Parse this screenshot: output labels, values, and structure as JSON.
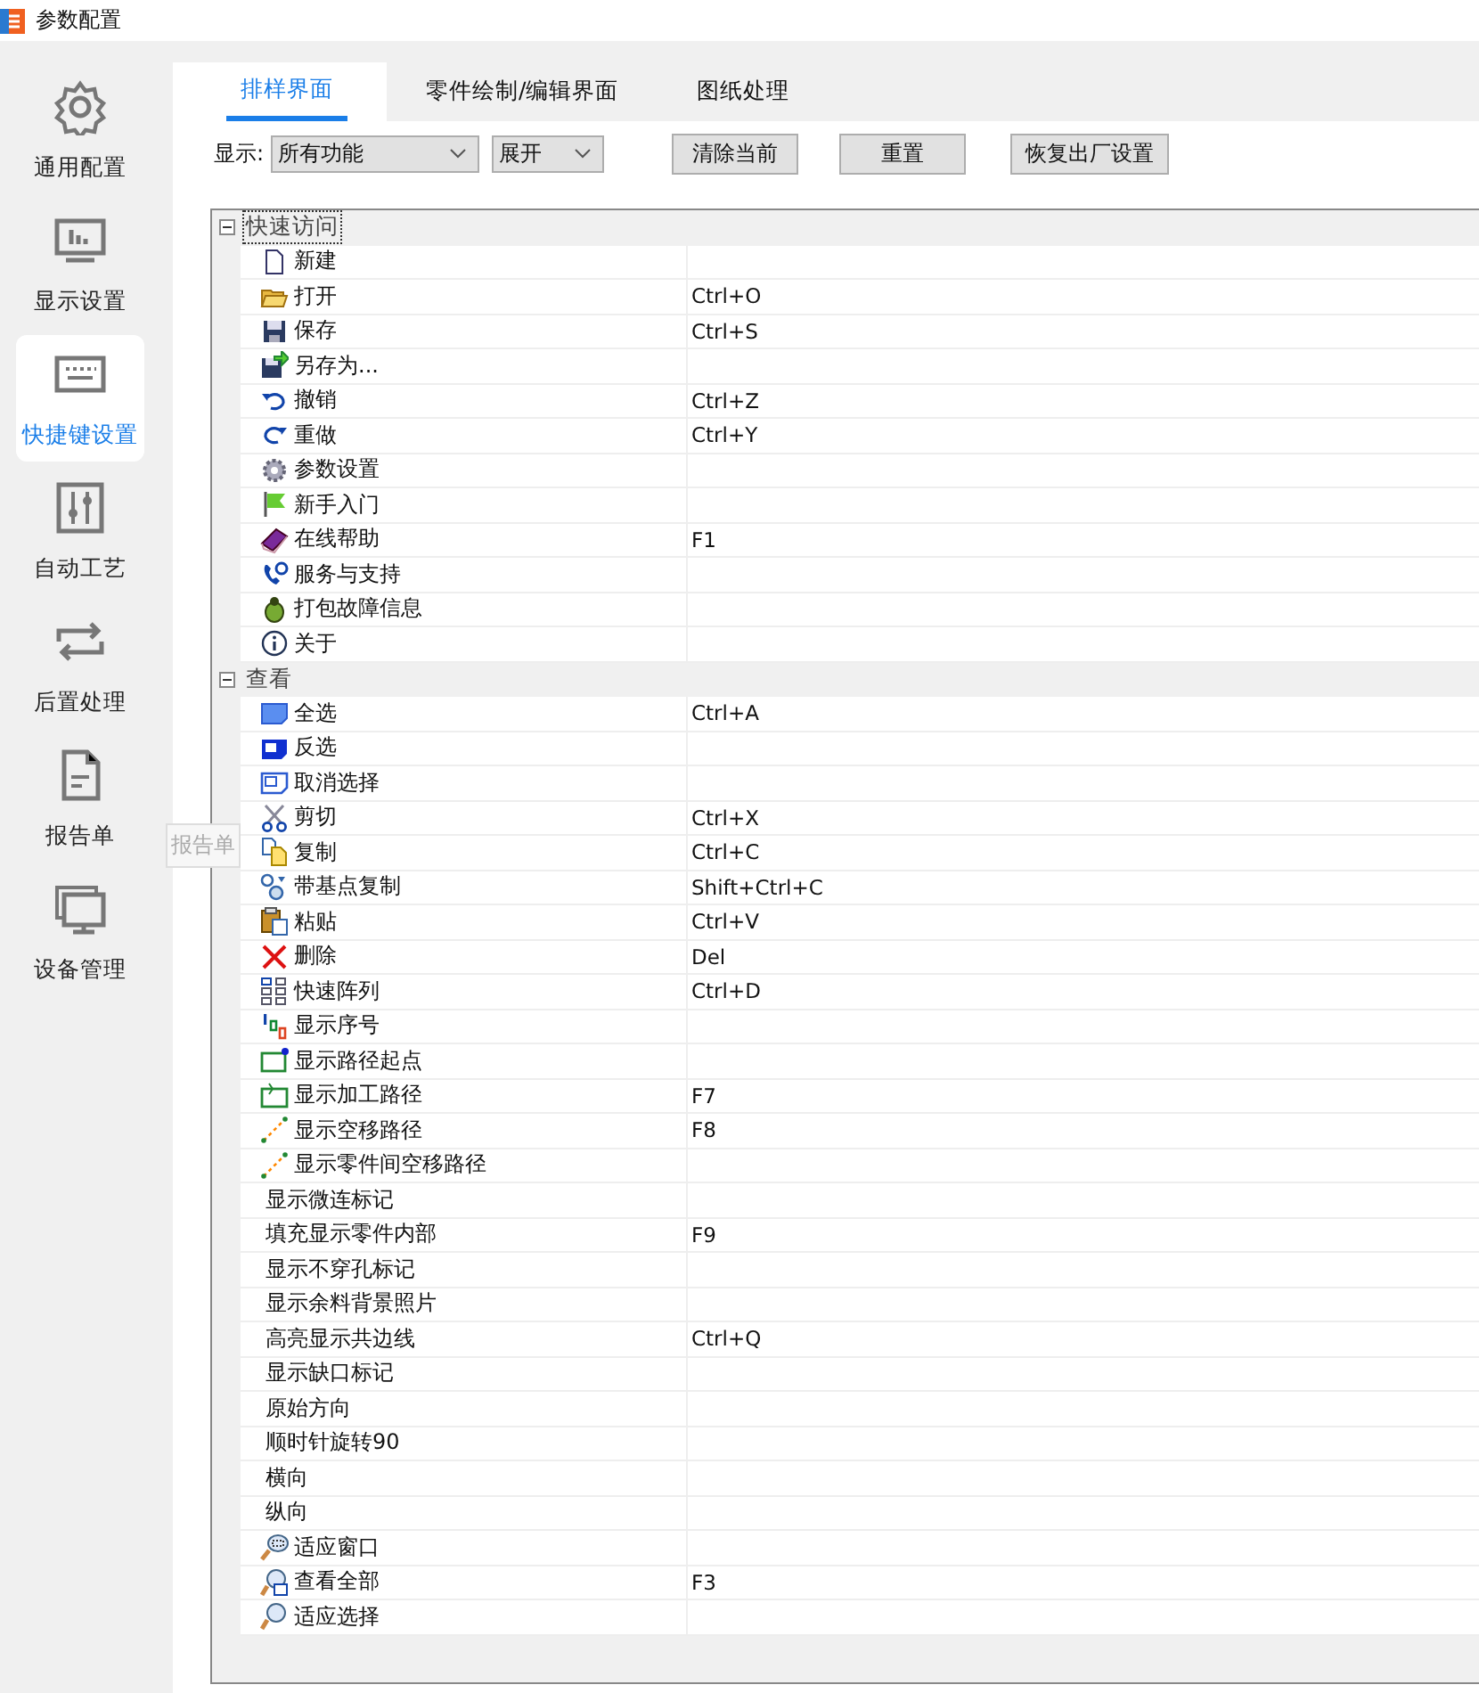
{
  "window": {
    "title": "参数配置"
  },
  "sidebar": {
    "items": [
      {
        "label": "通用配置",
        "kind": "gear",
        "selected": false
      },
      {
        "label": "显示设置",
        "kind": "display",
        "selected": false
      },
      {
        "label": "快捷键设置",
        "kind": "keyboard",
        "selected": true
      },
      {
        "label": "自动工艺",
        "kind": "sliders",
        "selected": false
      },
      {
        "label": "后置处理",
        "kind": "repeat",
        "selected": false
      },
      {
        "label": "报告单",
        "kind": "report",
        "selected": false
      },
      {
        "label": "设备管理",
        "kind": "monitor",
        "selected": false
      }
    ]
  },
  "tooltip": "报告单",
  "tabs": [
    {
      "label": "排样界面",
      "selected": true
    },
    {
      "label": "零件绘制/编辑界面",
      "selected": false
    },
    {
      "label": "图纸处理",
      "selected": false
    }
  ],
  "toolbar": {
    "label": "显示:",
    "filter": "所有功能",
    "expand": "展开",
    "buttons": [
      "清除当前",
      "重置",
      "恢复出厂设置"
    ]
  },
  "tree": [
    {
      "label": "快速访问",
      "expanded": true,
      "children": [
        {
          "label": "新建",
          "kind": "file"
        },
        {
          "label": "打开",
          "kind": "folder",
          "shortcut": "Ctrl+O"
        },
        {
          "label": "保存",
          "kind": "floppy",
          "shortcut": "Ctrl+S"
        },
        {
          "label": "另存为...",
          "kind": "saveas"
        },
        {
          "label": "撤销",
          "kind": "undo",
          "shortcut": "Ctrl+Z"
        },
        {
          "label": "重做",
          "kind": "redo",
          "shortcut": "Ctrl+Y"
        },
        {
          "label": "参数设置",
          "kind": "gear"
        },
        {
          "label": "新手入门",
          "kind": "flag"
        },
        {
          "label": "在线帮助",
          "kind": "book",
          "shortcut": "F1"
        },
        {
          "label": "服务与支持",
          "kind": "phone"
        },
        {
          "label": "打包故障信息",
          "kind": "bug"
        },
        {
          "label": "关于",
          "kind": "info"
        }
      ]
    },
    {
      "label": "查看",
      "expanded": true,
      "children": [
        {
          "label": "全选",
          "kind": "selall",
          "shortcut": "Ctrl+A"
        },
        {
          "label": "反选",
          "kind": "invert"
        },
        {
          "label": "取消选择",
          "kind": "deselect"
        },
        {
          "label": "剪切",
          "kind": "cut",
          "shortcut": "Ctrl+X"
        },
        {
          "label": "复制",
          "kind": "copy",
          "shortcut": "Ctrl+C"
        },
        {
          "label": "带基点复制",
          "kind": "basecopy",
          "shortcut": "Shift+Ctrl+C"
        },
        {
          "label": "粘贴",
          "kind": "paste",
          "shortcut": "Ctrl+V"
        },
        {
          "label": "删除",
          "kind": "delete",
          "shortcut": "Del"
        },
        {
          "label": "快速阵列",
          "kind": "grid",
          "shortcut": "Ctrl+D"
        },
        {
          "label": "显示序号",
          "kind": "sequence"
        },
        {
          "label": "显示路径起点",
          "kind": "pathstart"
        },
        {
          "label": "显示加工路径",
          "kind": "pathproc",
          "shortcut": "F7"
        },
        {
          "label": "显示空移路径",
          "kind": "rapid",
          "shortcut": "F8"
        },
        {
          "label": "显示零件间空移路径",
          "kind": "rapid"
        },
        {
          "label": "显示微连标记",
          "kind": "plain"
        },
        {
          "label": "填充显示零件内部",
          "kind": "plain",
          "shortcut": "F9"
        },
        {
          "label": "显示不穿孔标记",
          "kind": "plain"
        },
        {
          "label": "显示余料背景照片",
          "kind": "plain"
        },
        {
          "label": "高亮显示共边线",
          "kind": "plain",
          "shortcut": "Ctrl+Q"
        },
        {
          "label": "显示缺口标记",
          "kind": "plain"
        },
        {
          "label": "原始方向",
          "kind": "plain"
        },
        {
          "label": "顺时针旋转90",
          "kind": "plain"
        },
        {
          "label": "横向",
          "kind": "plain"
        },
        {
          "label": "纵向",
          "kind": "plain"
        },
        {
          "label": "适应窗口",
          "kind": "zoomwin"
        },
        {
          "label": "查看全部",
          "kind": "zoomall",
          "shortcut": "F3"
        },
        {
          "label": "适应选择",
          "kind": "zoomsel"
        }
      ]
    }
  ]
}
